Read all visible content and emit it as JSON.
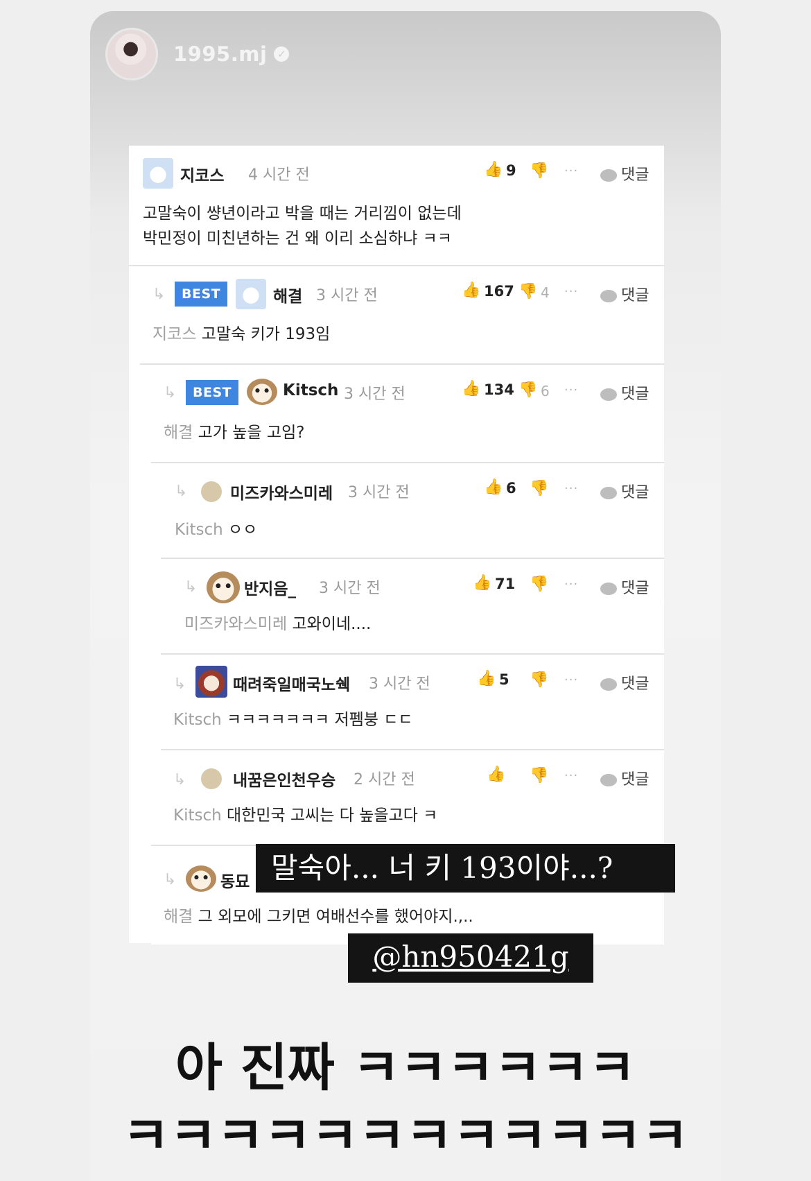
{
  "story": {
    "username": "1995.mj",
    "verified_glyph": "✓"
  },
  "comments": [
    {
      "name": "지코스",
      "time": "4 시간 전",
      "likes": "9",
      "dislikes": "",
      "more": "···",
      "reply_label": "댓글",
      "best": false,
      "lines": [
        "고말숙이 썅년이라고 박을 때는 거리낌이 없는데",
        "박민정이 미친년하는 건 왜 이리 소심하냐 ㅋㅋ"
      ],
      "mention": "",
      "avatar_icon": "white-dog-icon"
    },
    {
      "name": "해결",
      "time": "3 시간 전",
      "likes": "167",
      "dislikes": "4",
      "more": "···",
      "reply_label": "댓글",
      "best": true,
      "best_label": "BEST",
      "mention": "지코스",
      "text": "고말숙 키가 193임",
      "avatar_icon": "white-dog-icon"
    },
    {
      "name": "Kitsch",
      "time": "3 시간 전",
      "likes": "134",
      "dislikes": "6",
      "more": "···",
      "reply_label": "댓글",
      "best": true,
      "best_label": "BEST",
      "mention": "해결",
      "text": "고가 높을 고임?",
      "avatar_icon": "puppy-icon"
    },
    {
      "name": "미즈카와스미레",
      "time": "3 시간 전",
      "likes": "6",
      "dislikes": "",
      "more": "···",
      "reply_label": "댓글",
      "mention": "Kitsch",
      "text": "ㅇㅇ",
      "avatar_icon": "default-avatar-icon"
    },
    {
      "name": "반지음_",
      "time": "3 시간 전",
      "likes": "71",
      "dislikes": "",
      "more": "···",
      "reply_label": "댓글",
      "mention": "미즈카와스미레",
      "text": "고와이네....",
      "avatar_icon": "puppy-icon"
    },
    {
      "name": "때려죽일매국노쉑",
      "time": "3 시간 전",
      "likes": "5",
      "dislikes": "",
      "more": "···",
      "reply_label": "댓글",
      "mention": "Kitsch",
      "text": "ㅋㅋㅋㅋㅋㅋㅋ 저펨붕 ㄷㄷ",
      "avatar_icon": "lion-dog-icon"
    },
    {
      "name": "내꿈은인천우승",
      "time": "2 시간 전",
      "likes": "",
      "dislikes": "",
      "more": "···",
      "reply_label": "댓글",
      "mention": "Kitsch",
      "text": "대한민국 고씨는 다 높을고다 ㅋ",
      "avatar_icon": "default-avatar-icon"
    },
    {
      "name": "동묘",
      "time": "",
      "likes": "",
      "dislikes": "",
      "more": "",
      "reply_label": "",
      "mention": "해결",
      "text": "그 외모에 그키면 여배선수를 했어야지.,..",
      "avatar_icon": "puppy-icon"
    }
  ],
  "stickers": {
    "caption": "말숙아... 너 키 193이야...?",
    "tag": "@hn950421g"
  },
  "big_text": {
    "line1": "아 진짜 ㅋㅋㅋㅋㅋㅋ",
    "line2": "ㅋㅋㅋㅋㅋㅋㅋㅋㅋㅋㅋㅋ"
  },
  "glyphs": {
    "reply_arrow": "↳",
    "thumb_up": "👍",
    "thumb_down": "👎"
  }
}
